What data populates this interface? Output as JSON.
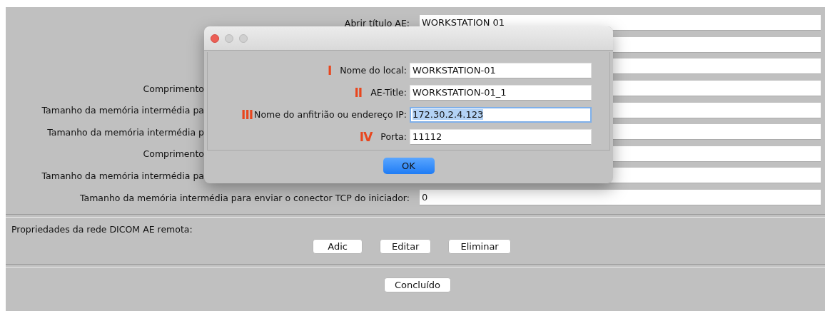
{
  "form": {
    "rows": [
      {
        "label": "Abrir título AE:",
        "label_cut": false,
        "value": "WORKSTATION 01"
      },
      {},
      {},
      {
        "label": "Comprimento",
        "label_cut": true
      },
      {
        "label": "Tamanho da memória intermédia pa",
        "label_cut": true
      },
      {
        "label": "Tamanho da memória intermédia p",
        "label_cut": true
      },
      {
        "label": "Comprimento",
        "label_cut": true
      },
      {
        "label": "Tamanho da memória intermédia pa",
        "label_cut": true
      },
      {
        "label": "Tamanho da memória intermédia para enviar o conector TCP do iniciador:",
        "label_cut": false,
        "value": "0"
      }
    ]
  },
  "remote": {
    "label": "Propriedades da rede DICOM AE remota:",
    "buttons": [
      "Adic",
      "Editar",
      "Eliminar"
    ]
  },
  "done_button": "Concluído",
  "dialog": {
    "fields": [
      {
        "marker": "I",
        "label": "Nome do local:",
        "value": "WORKSTATION-01",
        "focused": false
      },
      {
        "marker": "II",
        "label": "AE-Title:",
        "value": "WORKSTATION-01_1",
        "focused": false
      },
      {
        "marker": "III",
        "label": "Nome do anfitrião ou endereço IP:",
        "value": "172.30.2.4.123",
        "focused": true
      },
      {
        "marker": "IV",
        "label": "Porta:",
        "value": "11112",
        "focused": false
      }
    ],
    "ok_button": "OK"
  }
}
